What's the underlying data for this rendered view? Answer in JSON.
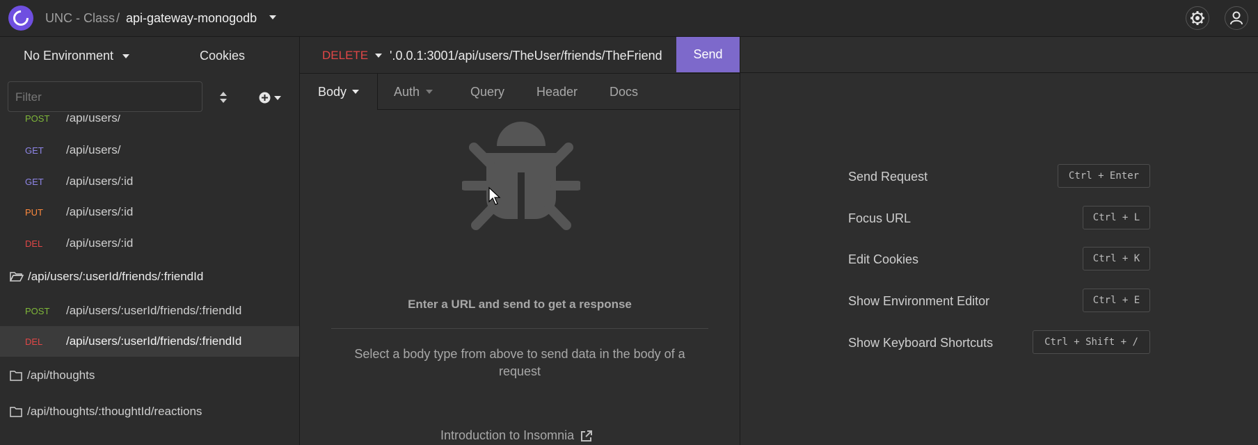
{
  "header": {
    "org": "UNC - Class",
    "separator": "/",
    "project": "api-gateway-monogodb"
  },
  "sidebar": {
    "environment": "No Environment",
    "cookies": "Cookies",
    "filter_placeholder": "Filter",
    "partial_row": {
      "method": "POST",
      "path": "/api/users/"
    },
    "items": [
      {
        "method": "GET",
        "path": "/api/users/"
      },
      {
        "method": "GET",
        "path": "/api/users/:id"
      },
      {
        "method": "PUT",
        "path": "/api/users/:id"
      },
      {
        "method": "DEL",
        "path": "/api/users/:id"
      }
    ],
    "open_folder": "/api/users/:userId/friends/:friendId",
    "folder_items": [
      {
        "method": "POST",
        "path": "/api/users/:userId/friends/:friendId"
      },
      {
        "method": "DEL",
        "path": "/api/users/:userId/friends/:friendId"
      }
    ],
    "folders": [
      "/api/thoughts",
      "/api/thoughts/:thoughtId/reactions"
    ]
  },
  "request": {
    "method": "DELETE",
    "url": "'.0.0.1:3001/api/users/TheUser/friends/TheFriend",
    "send_label": "Send",
    "tabs": [
      "Body",
      "Auth",
      "Query",
      "Header",
      "Docs"
    ]
  },
  "body_panel": {
    "empty_title": "Enter a URL and send to get a response",
    "hint": "Select a body type from above to send data in the body of a request",
    "intro_link": "Introduction to Insomnia"
  },
  "shortcuts": [
    {
      "label": "Send Request",
      "keys": "Ctrl + Enter"
    },
    {
      "label": "Focus URL",
      "keys": "Ctrl + L"
    },
    {
      "label": "Edit Cookies",
      "keys": "Ctrl + K"
    },
    {
      "label": "Show Environment Editor",
      "keys": "Ctrl + E"
    },
    {
      "label": "Show Keyboard Shortcuts",
      "keys": "Ctrl + Shift + /"
    }
  ],
  "colors": {
    "accent": "#7d69cb",
    "get": "#8f86e8",
    "put": "#ff8a3d",
    "delete": "#e14747",
    "post": "#7fb73a"
  }
}
